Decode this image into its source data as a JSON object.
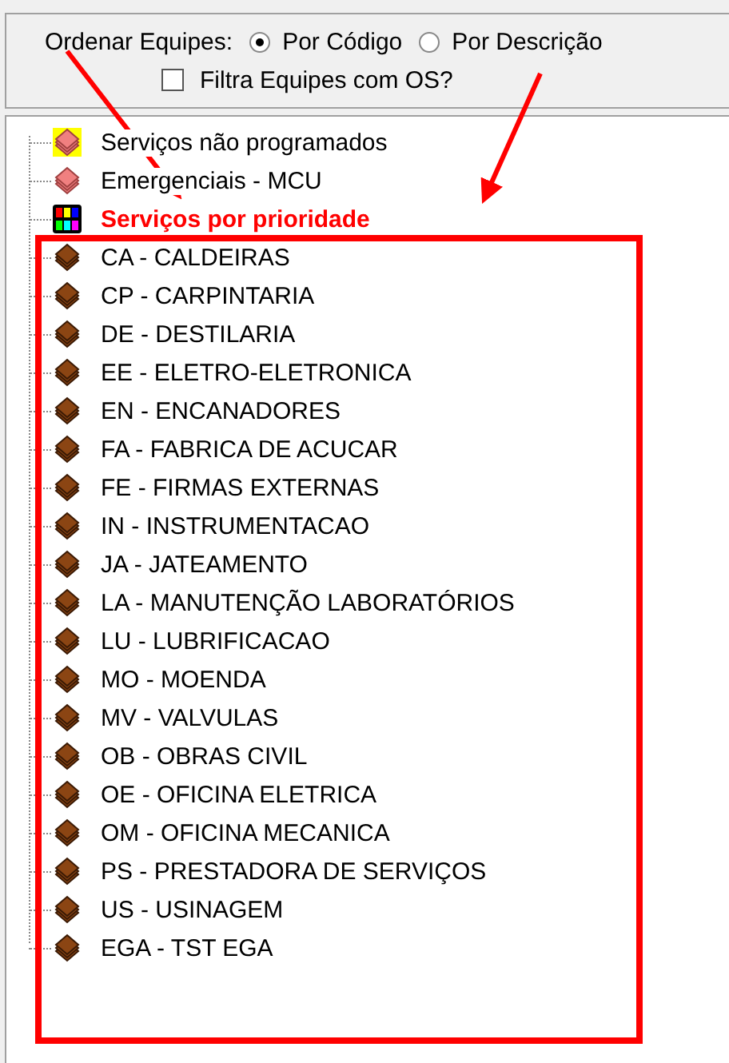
{
  "sort_panel": {
    "label": "Ordenar Equipes:",
    "options": [
      {
        "label": "Por Código",
        "selected": true
      },
      {
        "label": "Por Descrição",
        "selected": false
      }
    ],
    "filter": {
      "label": "Filtra Equipes com OS?",
      "checked": false
    }
  },
  "tree": {
    "items": [
      {
        "label": "Serviços não programados",
        "kind": "unscheduled"
      },
      {
        "label": "Emergenciais - MCU",
        "kind": "emergency"
      },
      {
        "label": "Serviços por prioridade",
        "kind": "priority"
      },
      {
        "label": "CA - CALDEIRAS",
        "kind": "team"
      },
      {
        "label": "CP - CARPINTARIA",
        "kind": "team"
      },
      {
        "label": "DE - DESTILARIA",
        "kind": "team"
      },
      {
        "label": "EE - ELETRO-ELETRONICA",
        "kind": "team"
      },
      {
        "label": "EN - ENCANADORES",
        "kind": "team"
      },
      {
        "label": "FA - FABRICA DE ACUCAR",
        "kind": "team"
      },
      {
        "label": "FE - FIRMAS EXTERNAS",
        "kind": "team"
      },
      {
        "label": "IN - INSTRUMENTACAO",
        "kind": "team"
      },
      {
        "label": "JA - JATEAMENTO",
        "kind": "team"
      },
      {
        "label": "LA - MANUTENÇÃO LABORATÓRIOS",
        "kind": "team"
      },
      {
        "label": "LU - LUBRIFICACAO",
        "kind": "team"
      },
      {
        "label": "MO - MOENDA",
        "kind": "team"
      },
      {
        "label": "MV - VALVULAS",
        "kind": "team"
      },
      {
        "label": "OB - OBRAS CIVIL",
        "kind": "team"
      },
      {
        "label": "OE - OFICINA ELETRICA",
        "kind": "team"
      },
      {
        "label": "OM - OFICINA MECANICA",
        "kind": "team"
      },
      {
        "label": "PS - PRESTADORA DE SERVIÇOS",
        "kind": "team"
      },
      {
        "label": "US - USINAGEM",
        "kind": "team"
      },
      {
        "label": "EGA - TST EGA",
        "kind": "team"
      }
    ]
  }
}
